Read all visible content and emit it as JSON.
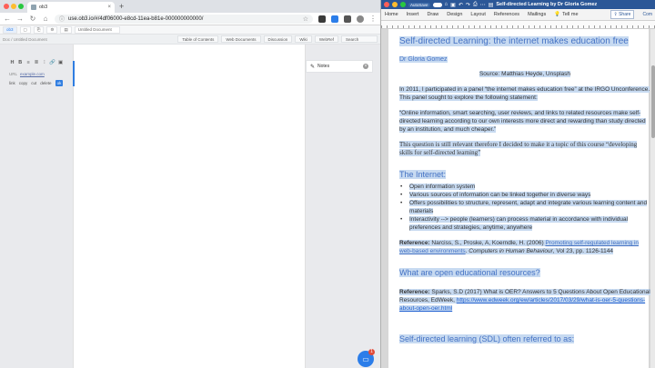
{
  "chrome": {
    "tab_title": "ob3",
    "tab_close": "×",
    "new_tab": "+",
    "url": "use.ob3.io/#/4df06000-e8cd-11ea-b81e-000000000000/",
    "nav_back": "←",
    "nav_forward": "→",
    "nav_reload": "↻",
    "nav_home": "⌂",
    "lock_icon": "ⓘ",
    "star_icon": "☆",
    "menu_icon": "⋮",
    "extension_colors": [
      "#3a3a3a",
      "#2b7de9",
      "#555555",
      "#888888"
    ]
  },
  "ob3": {
    "top_buttons": [
      "ob3",
      "",
      "",
      "",
      ""
    ],
    "breadcrumb": "Doc / Untitled Document",
    "doc_tab": "Untitled Document",
    "tabs": [
      "Table of Contents",
      "Web Documents",
      "Discussion",
      "Wiki",
      "WebRef"
    ],
    "search_placeholder": "Search",
    "format_buttons": [
      "H",
      "B",
      "≡",
      "≣",
      "⁝",
      "🔗",
      "▣"
    ],
    "link_prefix": "URL",
    "link_value": "example.com",
    "actions": [
      "link",
      "copy",
      "cut",
      "delete"
    ],
    "action_go": "ok",
    "notes_label": "Notes",
    "chat_badge": "1"
  },
  "word": {
    "autosave_label": "AutoSave",
    "toggle_label": "OFF",
    "doc_name": "Self-directed Learning by Dr Gloria Gomez",
    "menu": [
      "Home",
      "Insert",
      "Draw",
      "Design",
      "Layout",
      "References",
      "Mailings"
    ],
    "tell_me": "Tell me",
    "share": "Share",
    "comments": "Com",
    "title": "Self-directed Learning: the internet makes education free",
    "author": "Dr Gloria Gomez",
    "source": "Source: Matthias Heyde, Unsplash",
    "p1": "In 2011, I participated in a panel “the internet makes education free” at the IRGO Unconference. This panel sought to explore the following statement:",
    "p2": "“Online information, smart searching, user reviews, and links to related resources make self-directed learning according to our own interests more direct and rewarding than study directed by an institution, and much cheaper.”",
    "p3": "This question is still relevant therefore I decided to make it a topic of this course “developing skills for self-directed learning”",
    "h_internet": "The Internet:",
    "bullets": [
      "Open information system",
      "Various sources of information can be linked together in diverse ways",
      "Offers possibilities to structure, represent, adapt and integrate various learning content and materials",
      "Interactivity --> people (learners) can process material in accordance with individual preferences and strategies, anytime, anywhere"
    ],
    "ref1_label": "Reference:",
    "ref1_text": "Narciss, S., Proske, A, Koerndle, H. (2006)",
    "ref1_link": "Promoting self-regulated learning in web-based environments",
    "ref1_journal": "Computers in Human Behaviour",
    "ref1_tail": ", Vol 23, pp. 1126-1144",
    "h_oer": "What are open educational resources?",
    "ref2_label": "Reference:",
    "ref2_text": "Sparks, S.D (2017) What is OER? Answers to 5 Questions About Open Educational Resources, EdWeek,",
    "ref2_url": "https://www.edweek.org/ew/articles/2017/03/29/what-is-oer-5-questions-about-open-oer.html",
    "h_sdl": "Self-directed learning (SDL) often referred to as:"
  }
}
